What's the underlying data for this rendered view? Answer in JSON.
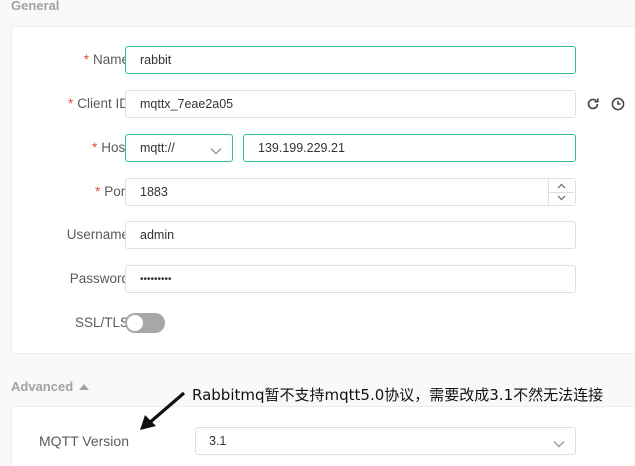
{
  "general": {
    "title": "General",
    "name": {
      "required": "*",
      "label": "Name",
      "value": "rabbit"
    },
    "client_id": {
      "required": "*",
      "label": "Client ID",
      "value": "mqttx_7eae2a05"
    },
    "host": {
      "required": "*",
      "label": "Host",
      "protocol": "mqtt://",
      "value": "139.199.229.21"
    },
    "port": {
      "required": "*",
      "label": "Port",
      "value": "1883"
    },
    "username": {
      "label": "Username",
      "value": "admin"
    },
    "password": {
      "label": "Password",
      "value": "•••••••••"
    },
    "ssl": {
      "label": "SSL/TLS",
      "enabled": false
    }
  },
  "advanced": {
    "title": "Advanced",
    "mqtt_version": {
      "label": "MQTT Version",
      "value": "3.1"
    }
  },
  "annotation": {
    "text": "Rabbitmq暂不支持mqtt5.0协议，需要改成3.1不然无法连接"
  },
  "colors": {
    "accent": "#34c388",
    "required": "#e74c3c",
    "toggle_off": "#a7a7a7"
  },
  "icons": [
    "refresh-icon",
    "clock-icon",
    "chevron-down-icon",
    "chevron-up-icon",
    "caret-up-icon",
    "arrow-icon"
  ]
}
